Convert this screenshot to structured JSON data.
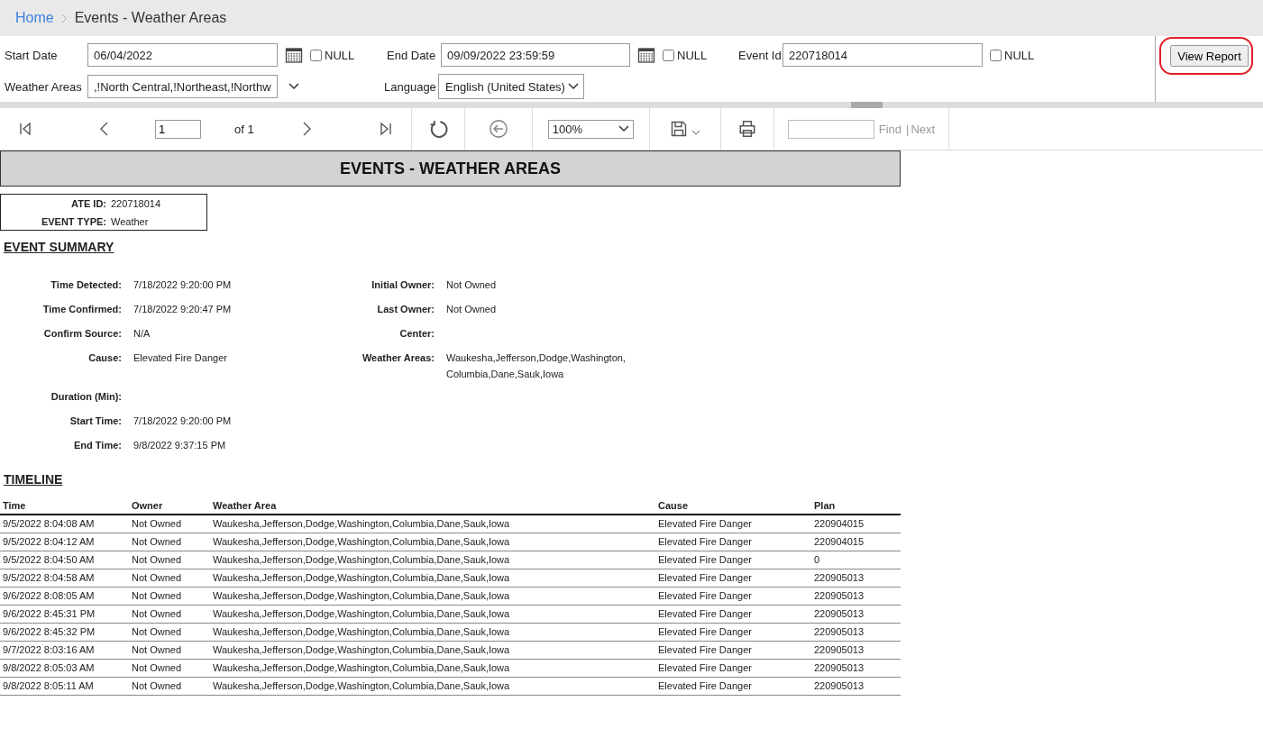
{
  "breadcrumb": [
    {
      "label": "Home",
      "kind": "link"
    },
    {
      "label": "Events - Weather Areas",
      "kind": "current"
    }
  ],
  "parameters": {
    "start_date": {
      "label": "Start Date",
      "value": "06/04/2022",
      "null_label": "NULL",
      "null_checked": false
    },
    "end_date": {
      "label": "End Date",
      "value": "09/09/2022 23:59:59",
      "null_label": "NULL",
      "null_checked": false
    },
    "event_id": {
      "label": "Event Id",
      "value": "220718014",
      "null_label": "NULL",
      "null_checked": false
    },
    "weather_areas": {
      "label": "Weather Areas",
      "value": ",!North Central,!Northeast,!Northw"
    },
    "language": {
      "label": "Language",
      "value": "English (United States)"
    },
    "view_report": {
      "label": "View Report",
      "highlighted": true
    }
  },
  "toolbar": {
    "page": "1",
    "page_of": "of 1",
    "zoom": "100%",
    "find_label": "Find",
    "separator": "|",
    "next_label": "Next"
  },
  "report": {
    "title": "EVENTS - WEATHER AREAS",
    "header_fields": [
      {
        "label": "ATE ID:",
        "value": "220718014"
      },
      {
        "label": "EVENT TYPE:",
        "value": "Weather"
      }
    ],
    "summary_title": "EVENT SUMMARY",
    "summary_left": [
      {
        "label": "Time Detected:",
        "value": "7/18/2022 9:20:00 PM"
      },
      {
        "label": "Time Confirmed:",
        "value": "7/18/2022 9:20:47 PM"
      },
      {
        "label": "Confirm Source:",
        "value": "N/A"
      },
      {
        "label": "Cause:",
        "value": "Elevated Fire Danger"
      },
      {
        "label": "Duration (Min):"
      },
      {
        "label": "Start Time:",
        "value": "7/18/2022 9:20:00 PM"
      },
      {
        "label": "End Time:",
        "value": "9/8/2022 9:37:15 PM"
      }
    ],
    "summary_right": [
      {
        "label": "Initial Owner:",
        "value": "Not Owned"
      },
      {
        "label": "Last Owner:",
        "value": "Not Owned"
      },
      {
        "label": "Center:"
      },
      {
        "label": "Weather Areas:",
        "value": "Waukesha,Jefferson,Dodge,Washington,Columbia,Dane,Sauk,Iowa"
      }
    ],
    "timeline_title": "TIMELINE",
    "columns": [
      "Time",
      "Owner",
      "Weather Area",
      "Cause",
      "Plan"
    ],
    "rows": [
      [
        "9/5/2022 8:04:08 AM",
        "Not Owned",
        "Waukesha,Jefferson,Dodge,Washington,Columbia,Dane,Sauk,Iowa",
        "Elevated Fire Danger",
        "220904015"
      ],
      [
        "9/5/2022 8:04:12 AM",
        "Not Owned",
        "Waukesha,Jefferson,Dodge,Washington,Columbia,Dane,Sauk,Iowa",
        "Elevated Fire Danger",
        "220904015"
      ],
      [
        "9/5/2022 8:04:50 AM",
        "Not Owned",
        "Waukesha,Jefferson,Dodge,Washington,Columbia,Dane,Sauk,Iowa",
        "Elevated Fire Danger",
        "0"
      ],
      [
        "9/5/2022 8:04:58 AM",
        "Not Owned",
        "Waukesha,Jefferson,Dodge,Washington,Columbia,Dane,Sauk,Iowa",
        "Elevated Fire Danger",
        "220905013"
      ],
      [
        "9/6/2022 8:08:05 AM",
        "Not Owned",
        "Waukesha,Jefferson,Dodge,Washington,Columbia,Dane,Sauk,Iowa",
        "Elevated Fire Danger",
        "220905013"
      ],
      [
        "9/6/2022 8:45:31 PM",
        "Not Owned",
        "Waukesha,Jefferson,Dodge,Washington,Columbia,Dane,Sauk,Iowa",
        "Elevated Fire Danger",
        "220905013"
      ],
      [
        "9/6/2022 8:45:32 PM",
        "Not Owned",
        "Waukesha,Jefferson,Dodge,Washington,Columbia,Dane,Sauk,Iowa",
        "Elevated Fire Danger",
        "220905013"
      ],
      [
        "9/7/2022 8:03:16 AM",
        "Not Owned",
        "Waukesha,Jefferson,Dodge,Washington,Columbia,Dane,Sauk,Iowa",
        "Elevated Fire Danger",
        "220905013"
      ],
      [
        "9/8/2022 8:05:03 AM",
        "Not Owned",
        "Waukesha,Jefferson,Dodge,Washington,Columbia,Dane,Sauk,Iowa",
        "Elevated Fire Danger",
        "220905013"
      ],
      [
        "9/8/2022 8:05:11 AM",
        "Not Owned",
        "Waukesha,Jefferson,Dodge,Washington,Columbia,Dane,Sauk,Iowa",
        "Elevated Fire Danger",
        "220905013"
      ]
    ]
  }
}
